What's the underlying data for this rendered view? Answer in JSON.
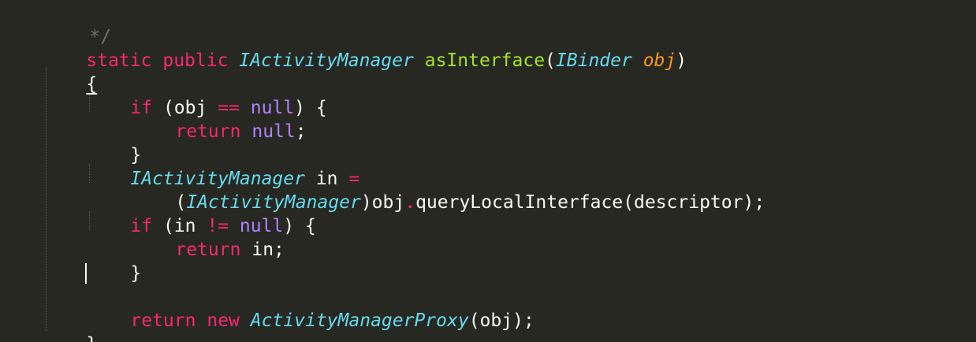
{
  "code": {
    "comment_end": "*/",
    "sig": {
      "static_kw": "static",
      "public_kw": "public",
      "return_type": "IActivityManager",
      "method_name": "asInterface",
      "open_paren": "(",
      "param_type": "IBinder",
      "param_name": "obj",
      "close_paren": ")"
    },
    "open_brace": "{",
    "if1": {
      "if_kw": "if",
      "open": "(obj ",
      "op": "==",
      "null_kw": "null",
      "close": ") {"
    },
    "ret_null": {
      "return_kw": "return",
      "null_kw": "null",
      "semi": ";"
    },
    "close_brace_1": "}",
    "decl": {
      "type": "IActivityManager",
      "var": " in ",
      "op": "="
    },
    "cast": {
      "open": "(",
      "type": "IActivityManager",
      "close_obj": ")obj",
      "dot": ".",
      "call": "queryLocalInterface(descriptor);"
    },
    "if2": {
      "if_kw": "if",
      "open": "(in ",
      "op": "!=",
      "null_kw": "null",
      "close": ") {"
    },
    "ret_in": {
      "return_kw": "return",
      "value": "in;"
    },
    "close_brace_2": "}",
    "ret_new": {
      "return_kw": "return",
      "new_kw": "new",
      "class": "ActivityManagerProxy",
      "args": "(obj);"
    },
    "close_brace_final": "}"
  },
  "theme": {
    "background": "#272822",
    "foreground": "#f8f8f2",
    "keyword": "#f92672",
    "type": "#66d9ef",
    "function": "#a6e22e",
    "parameter": "#fd971f",
    "constant": "#ae81ff",
    "comment": "#75715e"
  }
}
